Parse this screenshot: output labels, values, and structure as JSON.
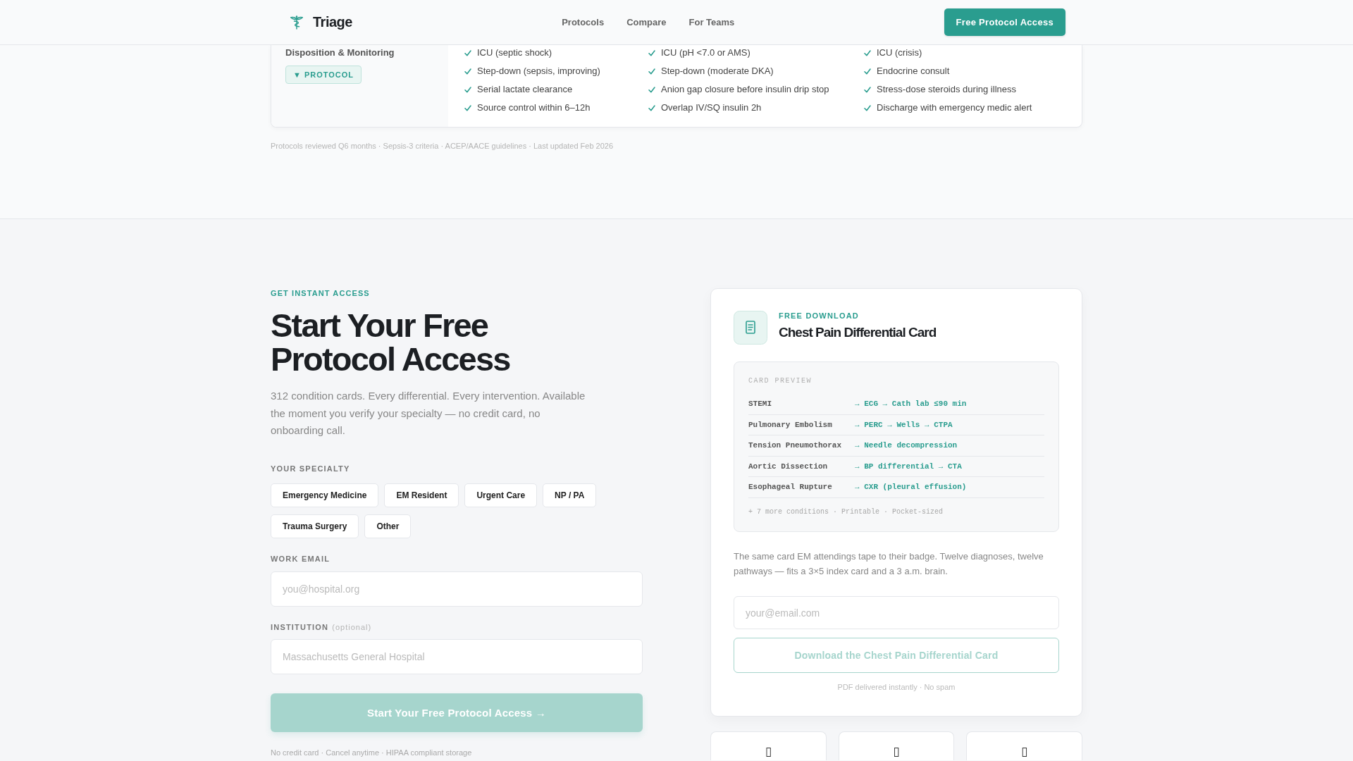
{
  "header": {
    "brand": "Triage",
    "nav": [
      {
        "label": "Protocols"
      },
      {
        "label": "Compare"
      },
      {
        "label": "For Teams"
      }
    ],
    "cta": "Free Protocol Access"
  },
  "protocol_table": {
    "rows": [
      {
        "label": "Disposition & Monitoring",
        "toggle": "▼ PROTOCOL",
        "cells": [
          [
            "ICU (septic shock)",
            "Step-down (sepsis, improving)",
            "Serial lactate clearance",
            "Source control within 6–12h"
          ],
          [
            "ICU (pH <7.0 or AMS)",
            "Step-down (moderate DKA)",
            "Anion gap closure before insulin drip stop",
            "Overlap IV/SQ insulin 2h"
          ],
          [
            "ICU (crisis)",
            "Endocrine consult",
            "Stress-dose steroids during illness",
            "Discharge with emergency medic alert"
          ]
        ]
      }
    ],
    "footnote": "Protocols reviewed Q6 months · Sepsis-3 criteria · ACEP/AACE guidelines · Last updated Feb 2026"
  },
  "signup": {
    "eyebrow": "GET INSTANT ACCESS",
    "title": "Start Your Free Protocol Access",
    "description": "312 condition cards. Every differential. Every intervention. Available the moment you verify your specialty — no credit card, no onboarding call.",
    "specialty": {
      "label": "YOUR SPECIALTY",
      "options": [
        {
          "label": "Emergency Medicine",
          "selected": false
        },
        {
          "label": "EM Resident",
          "selected": false
        },
        {
          "label": "Urgent Care",
          "selected": false
        },
        {
          "label": "NP / PA",
          "selected": false
        },
        {
          "label": "Trauma Surgery",
          "selected": false
        },
        {
          "label": "Other",
          "selected": false
        }
      ]
    },
    "fields": [
      {
        "label": "WORK EMAIL",
        "placeholder": "you@hospital.org"
      },
      {
        "label": "INSTITUTION",
        "hint": "(optional)",
        "placeholder": "Massachusetts General Hospital"
      }
    ],
    "submit": {
      "label": "Start Your Free Protocol Access →",
      "disabled": true
    },
    "footnote": "No credit card · Cancel anytime · HIPAA compliant storage"
  },
  "download_card": {
    "eyebrow": "FREE DOWNLOAD",
    "title": "Chest Pain Differential Card",
    "preview": {
      "label": "CARD PREVIEW",
      "rows": [
        {
          "condition": "STEMI",
          "pathway": "→ ECG → Cath lab ≤90 min"
        },
        {
          "condition": "Pulmonary Embolism",
          "pathway": "→ PERC → Wells → CTPA"
        },
        {
          "condition": "Tension Pneumothorax",
          "pathway": "→ Needle decompression"
        },
        {
          "condition": "Aortic Dissection",
          "pathway": "→ BP differential → CTA"
        },
        {
          "condition": "Esophageal Rupture",
          "pathway": "→ CXR (pleural effusion)"
        }
      ],
      "footnote": "+ 7 more conditions · Printable · Pocket-sized"
    },
    "description": "The same card EM attendings tape to their badge. Twelve diagnoses, twelve pathways — fits a 3×5 index card and a 3 a.m. brain.",
    "email_placeholder": "your@email.com",
    "button": {
      "label": "Download the Chest Pain Differential Card",
      "disabled": true
    },
    "footnote": "PDF delivered instantly · No spam"
  },
  "feature_tiles": [
    {
      "symbol": "▯"
    },
    {
      "symbol": "▯"
    },
    {
      "symbol": "▯"
    }
  ]
}
